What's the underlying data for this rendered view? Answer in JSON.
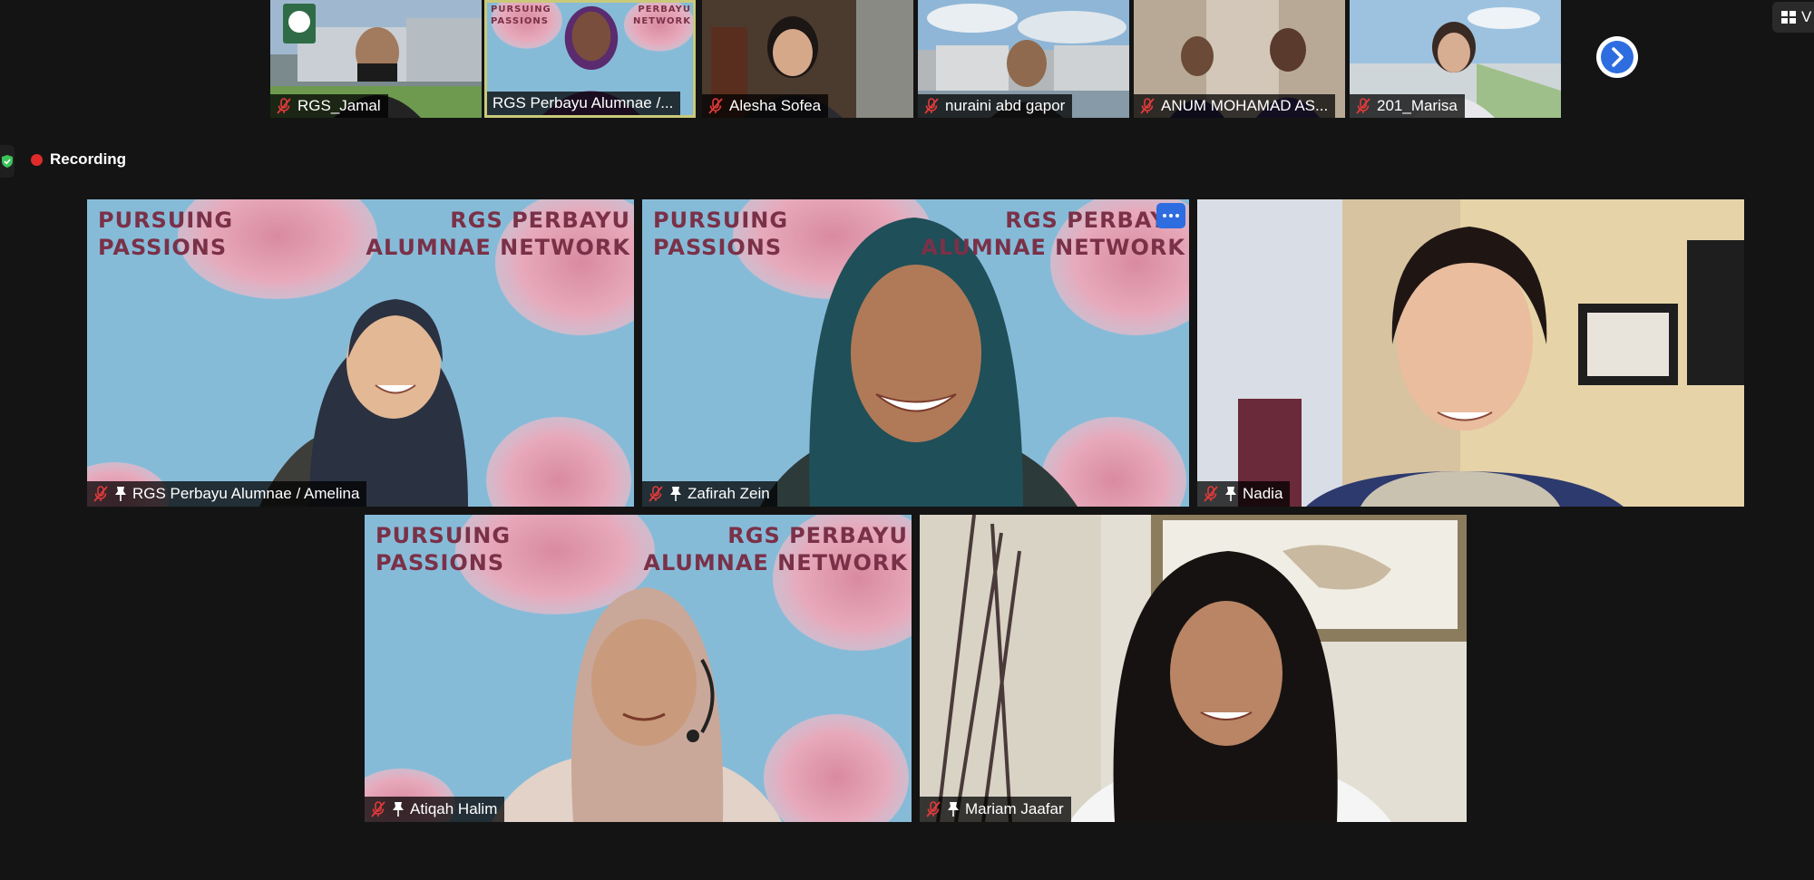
{
  "top_strip": [
    {
      "name": "RGS_Jamal"
    },
    {
      "name": "RGS Perbayu Alumnae /..."
    },
    {
      "name": "Alesha Sofea"
    },
    {
      "name": "nuraini abd gapor"
    },
    {
      "name": "ANUM MOHAMAD AS..."
    },
    {
      "name": "201_Marisa"
    }
  ],
  "recording": {
    "label": "Recording"
  },
  "view_button": {
    "label": "V"
  },
  "background_text": {
    "left": "PURSUING\nPASSIONS",
    "right": "RGS PERBAYU\nALUMNAE NETWORK",
    "strip_left": "PURSUING\nPASSIONS",
    "strip_right": "PERBAYU\nNETWORK"
  },
  "gallery": [
    {
      "name": "RGS Perbayu Alumnae / Amelina"
    },
    {
      "name": "Zafirah Zein"
    },
    {
      "name": "Nadia"
    },
    {
      "name": "Atiqah Halim"
    },
    {
      "name": "Mariam Jaafar"
    }
  ],
  "colors": {
    "background": "#141414",
    "virtual_bg": "#86bbd8",
    "bg_text": "#7a3148",
    "recording_dot": "#e02b2b",
    "active_speaker_border": "#c9c97a",
    "more_button": "#2d6de0"
  }
}
